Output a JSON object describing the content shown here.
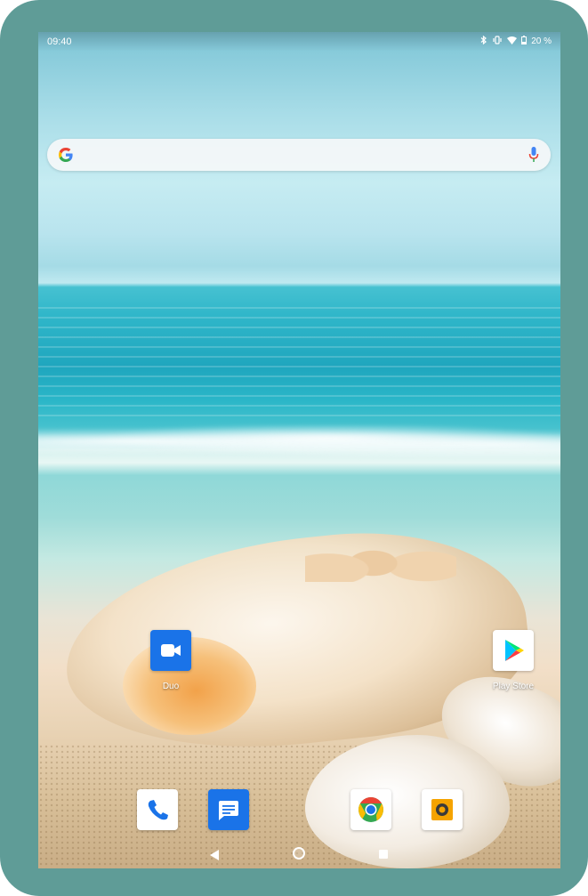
{
  "status_bar": {
    "time": "09:40",
    "icons": [
      "bluetooth-icon",
      "vibrate-icon",
      "wifi-icon",
      "battery-icon"
    ],
    "battery_text": "20 %"
  },
  "search_bar": {
    "logo": "google-g-icon",
    "mic": "microphone-icon"
  },
  "home_apps": [
    {
      "name": "duo",
      "label": "Duo",
      "icon": "video-camera-icon",
      "color": "#1a73e8"
    },
    {
      "name": "play-store",
      "label": "Play Store",
      "icon": "play-store-icon",
      "color": "#ffffff"
    }
  ],
  "dock": [
    {
      "name": "phone",
      "icon": "phone-icon",
      "color": "#ffffff"
    },
    {
      "name": "messages",
      "icon": "message-icon",
      "color": "#1a73e8"
    },
    {
      "name": "chrome",
      "icon": "chrome-icon",
      "color": "#ffffff"
    },
    {
      "name": "camera",
      "icon": "camera-icon",
      "color": "#ffffff"
    }
  ],
  "nav_bar": {
    "buttons": [
      "back-icon",
      "home-icon",
      "recents-icon"
    ]
  },
  "colors": {
    "bezel": "#5f9c97",
    "accent_blue": "#1a73e8",
    "mic_blue": "#4285f4",
    "mic_red": "#ea4335"
  }
}
